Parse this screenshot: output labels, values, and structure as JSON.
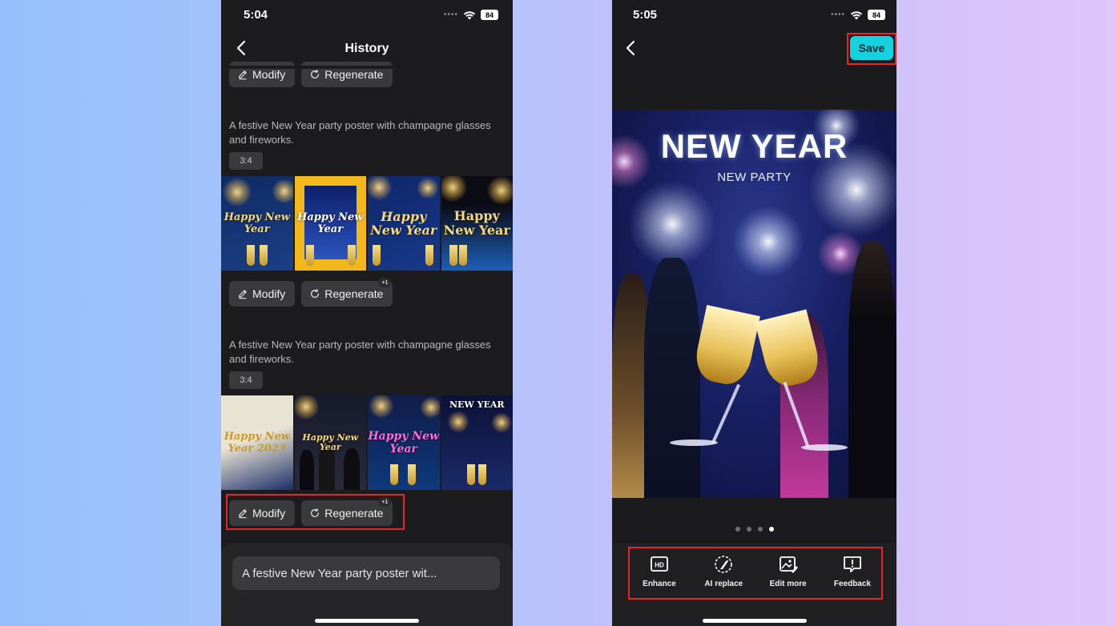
{
  "left_phone": {
    "status": {
      "time": "5:04",
      "battery": "84"
    },
    "nav": {
      "title": "History"
    },
    "top_actions": {
      "modify": "Modify",
      "regenerate": "Regenerate"
    },
    "groups": [
      {
        "prompt": "A festive New Year party poster with champagne glasses and fireworks.",
        "ratio": "3:4",
        "images": [
          {
            "text": "Happy New Year",
            "colors": [
              "#0f2a62",
              "#1b3f86"
            ]
          },
          {
            "text": "Happy New Year",
            "colors": [
              "#f2b71a",
              "#1d3f9a"
            ]
          },
          {
            "text": "Happy New Year",
            "colors": [
              "#10266a",
              "#173a8a"
            ]
          },
          {
            "text": "Happy New Year",
            "colors": [
              "#0b0b14",
              "#1d5fb8"
            ]
          }
        ],
        "modify": "Modify",
        "regenerate": "Regenerate",
        "badge": "+1"
      },
      {
        "prompt": "A festive New Year party poster with champagne glasses and fireworks.",
        "ratio": "3:4",
        "images": [
          {
            "text": "Happy New Year 2023",
            "colors": [
              "#e9e3d3",
              "#1b2f6a"
            ]
          },
          {
            "text": "Happy New Year",
            "colors": [
              "#151a2c",
              "#2a2a3a"
            ]
          },
          {
            "text": "Happy New Year",
            "colors": [
              "#101c4a",
              "#0e3a7c"
            ]
          },
          {
            "text": "NEW YEAR",
            "colors": [
              "#0c1136",
              "#1a2a6a"
            ]
          }
        ],
        "modify": "Modify",
        "regenerate": "Regenerate",
        "badge": "+1"
      }
    ],
    "input": {
      "value": "A festive New Year party poster wit..."
    }
  },
  "right_phone": {
    "status": {
      "time": "5:05",
      "battery": "84"
    },
    "save_label": "Save",
    "poster": {
      "title": "NEW YEAR",
      "subtitle": "NEW PARTY"
    },
    "carousel": {
      "count": 4,
      "active_index": 3
    },
    "tools": [
      {
        "label": "Enhance",
        "icon": "hd-icon"
      },
      {
        "label": "AI replace",
        "icon": "ai-replace-icon"
      },
      {
        "label": "Edit more",
        "icon": "edit-image-icon"
      },
      {
        "label": "Feedback",
        "icon": "feedback-icon"
      }
    ]
  },
  "colors": {
    "accent": "#14d2e0",
    "highlight": "#e5252a",
    "background": "#1c1c1e"
  }
}
